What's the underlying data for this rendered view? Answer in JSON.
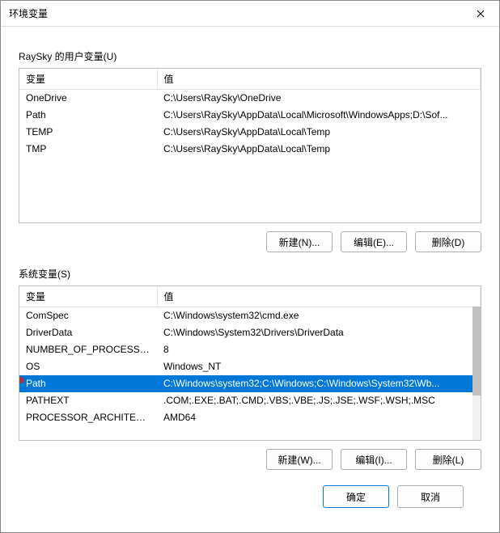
{
  "window_title": "环境变量",
  "user_section_label": "RaySky 的用户变量(U)",
  "system_section_label": "系统变量(S)",
  "columns": {
    "name": "变量",
    "value": "值"
  },
  "user_vars": [
    {
      "name": "OneDrive",
      "value": "C:\\Users\\RaySky\\OneDrive"
    },
    {
      "name": "Path",
      "value": "C:\\Users\\RaySky\\AppData\\Local\\Microsoft\\WindowsApps;D:\\Sof..."
    },
    {
      "name": "TEMP",
      "value": "C:\\Users\\RaySky\\AppData\\Local\\Temp"
    },
    {
      "name": "TMP",
      "value": "C:\\Users\\RaySky\\AppData\\Local\\Temp"
    }
  ],
  "system_vars": [
    {
      "name": "ComSpec",
      "value": "C:\\Windows\\system32\\cmd.exe",
      "selected": false
    },
    {
      "name": "DriverData",
      "value": "C:\\Windows\\System32\\Drivers\\DriverData",
      "selected": false
    },
    {
      "name": "NUMBER_OF_PROCESSORS",
      "value": "8",
      "selected": false
    },
    {
      "name": "OS",
      "value": "Windows_NT",
      "selected": false
    },
    {
      "name": "Path",
      "value": "C:\\Windows\\system32;C:\\Windows;C:\\Windows\\System32\\Wb...",
      "selected": true
    },
    {
      "name": "PATHEXT",
      "value": ".COM;.EXE;.BAT;.CMD;.VBS;.VBE;.JS;.JSE;.WSF;.WSH;.MSC",
      "selected": false
    },
    {
      "name": "PROCESSOR_ARCHITECT...",
      "value": "AMD64",
      "selected": false
    }
  ],
  "buttons": {
    "user_new": "新建(N)...",
    "user_edit": "编辑(E)...",
    "user_delete": "删除(D)",
    "sys_new": "新建(W)...",
    "sys_edit": "编辑(I)...",
    "sys_delete": "删除(L)",
    "ok": "确定",
    "cancel": "取消"
  }
}
